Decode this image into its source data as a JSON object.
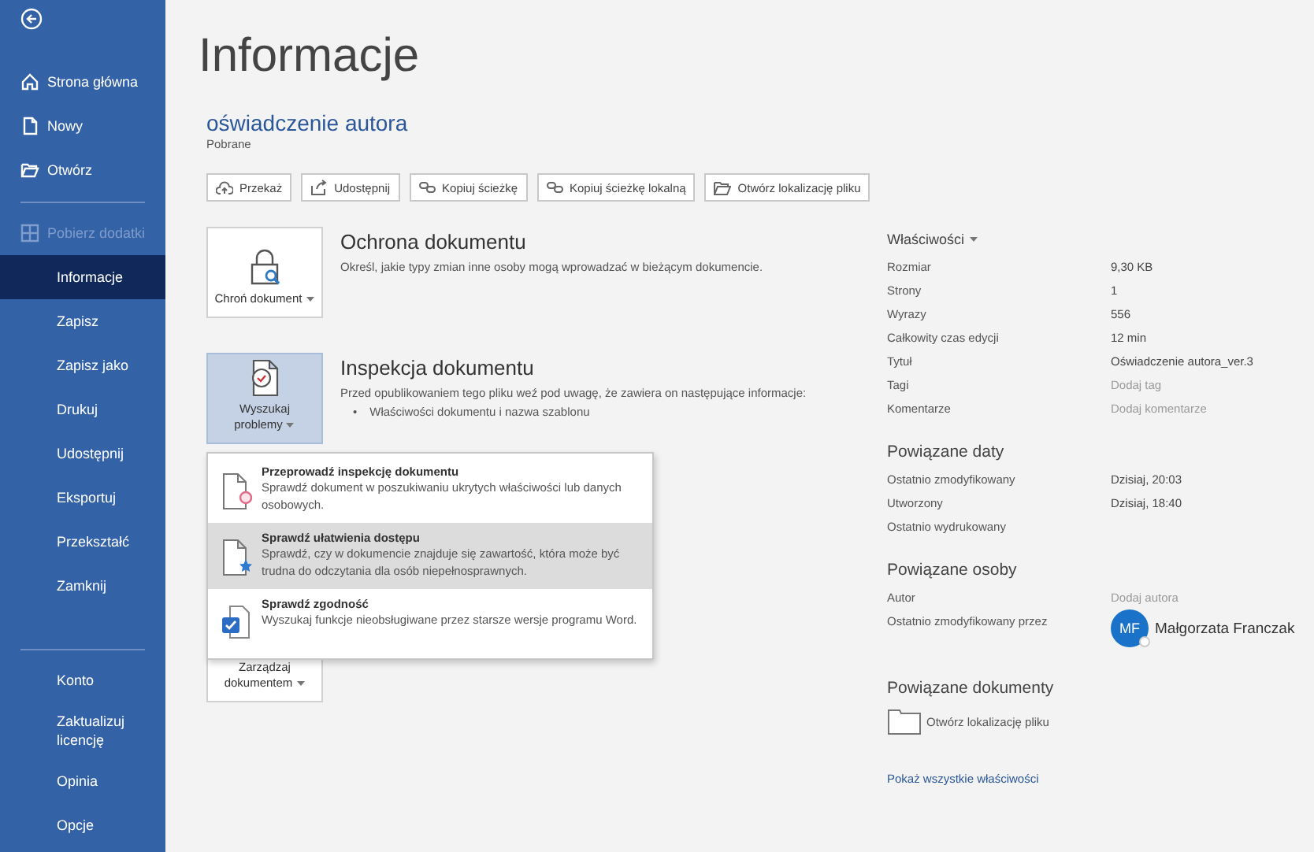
{
  "sidebar": {
    "top_items": [
      {
        "label": "Strona główna",
        "selected": false
      },
      {
        "label": "Nowy",
        "selected": false
      },
      {
        "label": "Otwórz",
        "selected": false
      }
    ],
    "add_ins": {
      "label": "Pobierz dodatki",
      "disabled": true
    },
    "items": [
      {
        "label": "Informacje",
        "selected": true
      },
      {
        "label": "Zapisz",
        "selected": false
      },
      {
        "label": "Zapisz jako",
        "selected": false
      },
      {
        "label": "Drukuj",
        "selected": false
      },
      {
        "label": "Udostępnij",
        "selected": false
      },
      {
        "label": "Eksportuj",
        "selected": false
      },
      {
        "label": "Przekształć",
        "selected": false
      },
      {
        "label": "Zamknij",
        "selected": false
      }
    ],
    "bottom_items": [
      {
        "label": "Konto",
        "selected": false
      },
      {
        "label": "Zaktualizuj licencję",
        "selected": false
      },
      {
        "label": "Opinia",
        "selected": false
      },
      {
        "label": "Opcje",
        "selected": false
      }
    ]
  },
  "title": "Informacje",
  "document": {
    "name": "oświadczenie autora",
    "location": "Pobrane"
  },
  "actions": [
    "Przekaż",
    "Udostępnij",
    "Kopiuj ścieżkę",
    "Kopiuj ścieżkę lokalną",
    "Otwórz lokalizację pliku"
  ],
  "sections": [
    {
      "button": "Chroń dokument",
      "heading": "Ochrona dokumentu",
      "description": "Określ, jakie typy zmian inne osoby mogą wprowadzać w bieżącym dokumencie.",
      "selected": false
    },
    {
      "button": "Wyszukaj problemy",
      "heading": "Inspekcja dokumentu",
      "description": "Przed opublikowaniem tego pliku weź pod uwagę, że zawiera on następujące informacje:",
      "bullets": [
        {
          "marker": "•",
          "text": "Właściwości dokumentu i nazwa szablonu"
        }
      ],
      "selected": true
    },
    {
      "button": "Zarządzaj dokumentem",
      "selected": false
    }
  ],
  "dropdown": {
    "items": [
      {
        "title": "Przeprowadź inspekcję dokumentu",
        "description": "Sprawdź dokument w poszukiwaniu ukrytych właściwości lub danych osobowych.",
        "selected": false
      },
      {
        "title": "Sprawdź ułatwienia dostępu",
        "description": "Sprawdź, czy w dokumencie znajduje się zawartość, która może być trudna do odczytania dla osób niepełnosprawnych.",
        "selected": true
      },
      {
        "title": "Sprawdź zgodność",
        "description": "Wyszukaj funkcje nieobsługiwane przez starsze wersje programu Word.",
        "selected": false
      }
    ]
  },
  "properties": {
    "heading": "Właściwości",
    "rows": [
      {
        "label": "Rozmiar",
        "value": "9,30 KB",
        "kind": "value"
      },
      {
        "label": "Strony",
        "value": "1",
        "kind": "value"
      },
      {
        "label": "Wyrazy",
        "value": "556",
        "kind": "value"
      },
      {
        "label": "Całkowity czas edycji",
        "value": "12 min",
        "kind": "value"
      },
      {
        "label": "Tytuł",
        "value": "Oświadczenie autora_ver.3",
        "kind": "value"
      },
      {
        "label": "Tagi",
        "placeholder": "Dodaj tag",
        "kind": "prompt"
      },
      {
        "label": "Komentarze",
        "placeholder": "Dodaj komentarze",
        "kind": "prompt"
      }
    ]
  },
  "related_dates": {
    "heading": "Powiązane daty",
    "rows": [
      {
        "label": "Ostatnio zmodyfikowany",
        "value": "Dzisiaj, 20:03",
        "kind": "value"
      },
      {
        "label": "Utworzony",
        "value": "Dzisiaj, 18:40",
        "kind": "value"
      },
      {
        "label": "Ostatnio wydrukowany",
        "kind": "value"
      }
    ]
  },
  "related_people": {
    "heading": "Powiązane osoby",
    "rows": [
      {
        "label": "Autor",
        "placeholder": "Dodaj autora",
        "kind": "prompt"
      },
      {
        "label": "Ostatnio zmodyfikowany przez",
        "value": "Małgorzata Franczak",
        "initials": "MF",
        "kind": "person"
      }
    ]
  },
  "related_documents": {
    "heading": "Powiązane dokumenty",
    "open_location": "Otwórz lokalizację pliku",
    "show_all": "Pokaż wszystkie właściwości"
  }
}
